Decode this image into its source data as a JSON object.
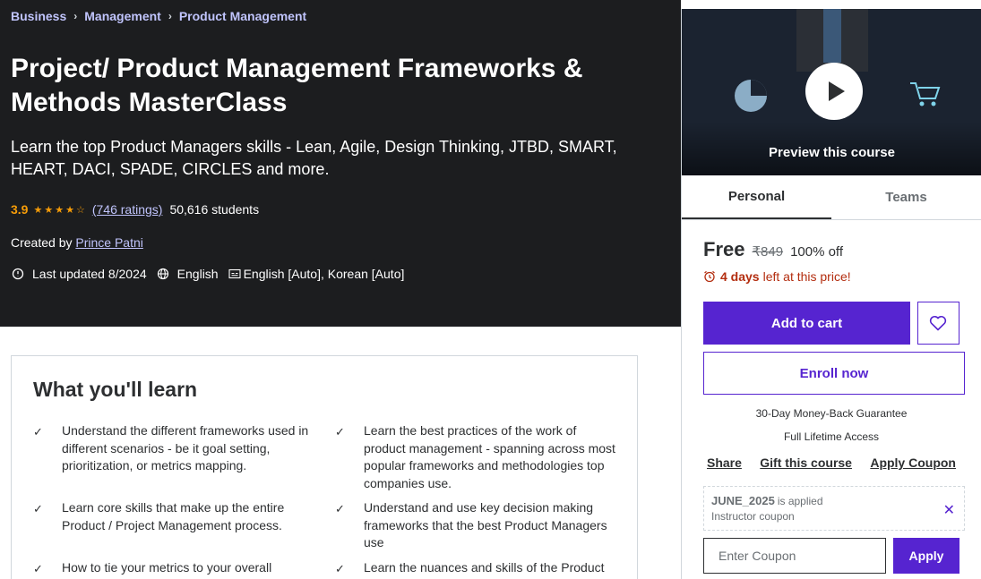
{
  "breadcrumb": [
    "Business",
    "Management",
    "Product Management"
  ],
  "course": {
    "title": "Project/ Product Management Frameworks & Methods MasterClass",
    "subtitle": "Learn the top Product Managers skills - Lean, Agile, Design Thinking, JTBD, SMART, HEART, DACI, SPADE, CIRCLES and more.",
    "rating": "3.9",
    "rating_stars": 3.9,
    "ratings_count": "(746 ratings)",
    "students": "50,616 students",
    "created_by_label": "Created by",
    "author": "Prince Patni",
    "last_updated": "Last updated 8/2024",
    "language": "English",
    "captions": "English [Auto], Korean [Auto]"
  },
  "learn": {
    "heading": "What you'll learn",
    "items": [
      "Understand the different frameworks used in different scenarios - be it goal setting, prioritization, or metrics mapping.",
      "Learn the best practices of the work of product management - spanning across most popular frameworks and methodologies top companies use.",
      "Learn core skills that make up the entire Product / Project Management process.",
      "Understand and use key decision making frameworks that the best Product Managers use",
      "How to tie your metrics to your overall",
      "Learn the nuances and skills of the Product"
    ]
  },
  "sidebar": {
    "preview_label": "Preview this course",
    "tabs": [
      "Personal",
      "Teams"
    ],
    "price_current": "Free",
    "price_original": "₹849",
    "discount": "100% off",
    "deadline_bold": "4 days",
    "deadline_rest": "left at this price!",
    "add_to_cart": "Add to cart",
    "enroll_now": "Enroll now",
    "guarantee": "30-Day Money-Back Guarantee",
    "lifetime": "Full Lifetime Access",
    "links": [
      "Share",
      "Gift this course",
      "Apply Coupon"
    ],
    "coupon_code": "JUNE_2025",
    "coupon_applied": "is applied",
    "coupon_type": "Instructor coupon",
    "coupon_placeholder": "Enter Coupon",
    "apply": "Apply"
  },
  "colors": {
    "hero_bg": "#1c1d1f",
    "link": "#c0c4fc",
    "star": "#f69c08",
    "brand": "#5624d0",
    "deadline": "#b32d0f"
  }
}
